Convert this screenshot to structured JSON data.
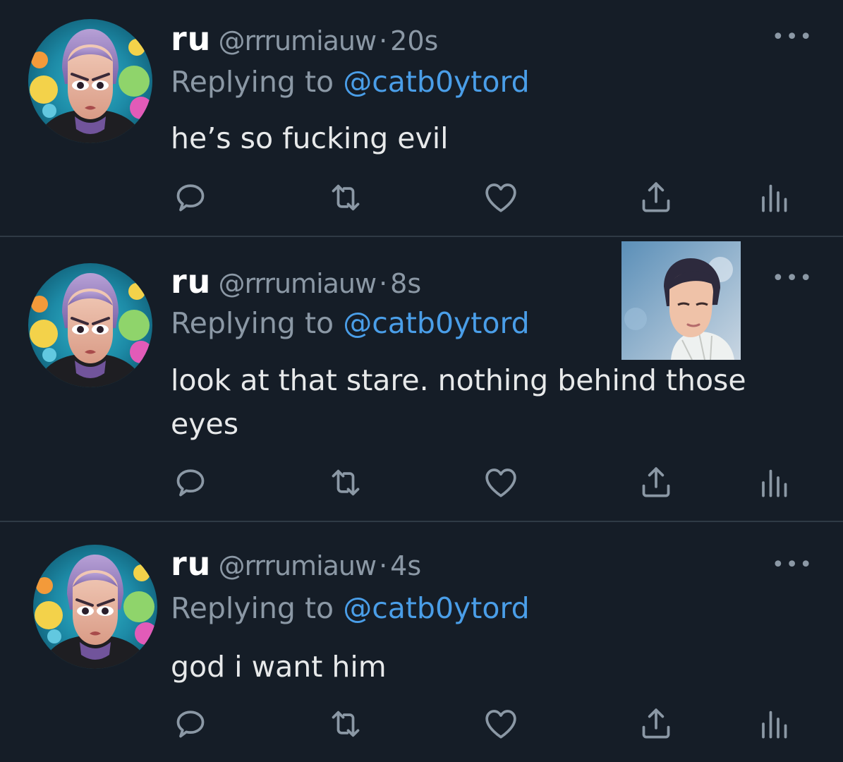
{
  "colors": {
    "background": "#151d27",
    "divider": "#2f3a45",
    "secondary_text": "#8b98a5",
    "mention": "#4a9ee8",
    "primary_text": "#e7e9ea"
  },
  "tweets": [
    {
      "display_name": "ru",
      "handle": "@rrrumiauw",
      "dot": "·",
      "time": "20s",
      "reply_prefix": "Replying to ",
      "reply_to": "@catb0ytord",
      "text": "he’s so fucking evil",
      "more": "•••"
    },
    {
      "display_name": "ru",
      "handle": "@rrrumiauw",
      "dot": "·",
      "time": "8s",
      "reply_prefix": "Replying to ",
      "reply_to": "@catb0ytord",
      "text": "look at that stare. nothing behind those eyes",
      "more": "•••"
    },
    {
      "display_name": "ru",
      "handle": "@rrrumiauw",
      "dot": "·",
      "time": "4s",
      "reply_prefix": "Replying to ",
      "reply_to": "@catb0ytord",
      "text": "god i want him",
      "more": "•••"
    }
  ],
  "icons": {
    "reply": "reply-icon",
    "retweet": "retweet-icon",
    "like": "heart-icon",
    "share": "share-icon",
    "stats": "analytics-icon",
    "more": "more-icon"
  }
}
